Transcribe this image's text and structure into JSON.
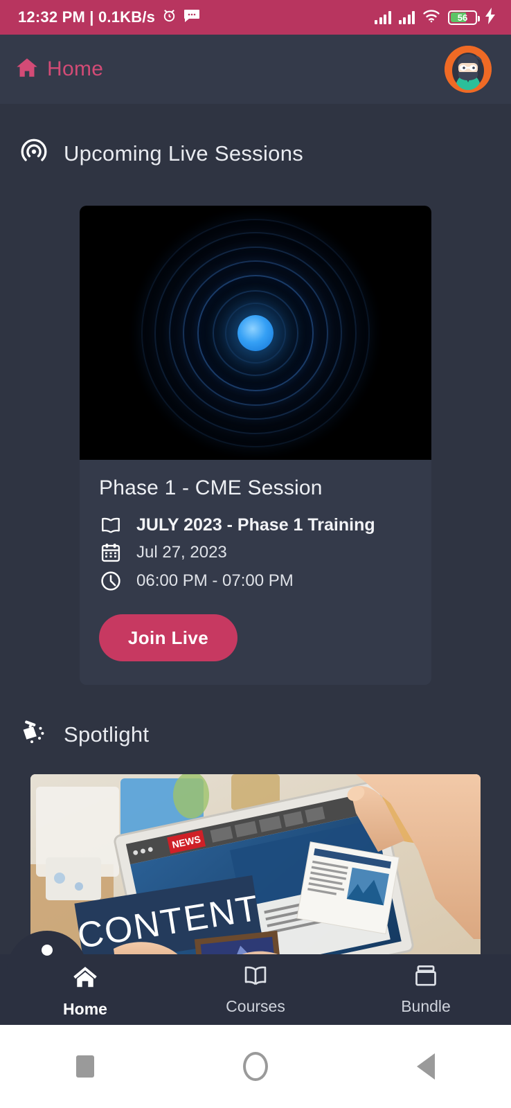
{
  "status_bar": {
    "time_and_speed": "12:32 PM | 0.1KB/s",
    "battery_level": "56",
    "icons": [
      "alarm-clock-icon",
      "message-icon",
      "signal-icon",
      "signal-icon",
      "wifi-icon",
      "battery-icon",
      "charging-bolt-icon"
    ],
    "background_color": "#b8355f"
  },
  "header": {
    "title": "Home",
    "home_icon": "home-icon",
    "accent_color": "#d34b76",
    "avatar": "ninja-avatar"
  },
  "sections": {
    "live": {
      "icon": "broadcast-icon",
      "title": "Upcoming Live Sessions"
    },
    "spotlight": {
      "icon": "spotlight-lamp-icon",
      "title": "Spotlight"
    }
  },
  "live_card": {
    "thumbnail": "blue-sonar-rings-graphic",
    "session_title": "Phase 1 - CME Session",
    "course": {
      "icon": "book-icon",
      "text": "JULY 2023 - Phase 1 Training"
    },
    "date": {
      "icon": "calendar-icon",
      "text": "Jul 27, 2023"
    },
    "time": {
      "icon": "clock-icon",
      "text": "06:00 PM - 07:00 PM"
    },
    "join_button": {
      "label": "Join Live",
      "color": "#c73961"
    }
  },
  "spotlight_card": {
    "image": "content-news-tablet-photo",
    "banner_text": "CONTENT"
  },
  "bottom_nav": {
    "items": [
      {
        "label": "Home",
        "icon": "home-icon",
        "active": true
      },
      {
        "label": "Courses",
        "icon": "open-book-icon",
        "active": false
      },
      {
        "label": "Bundle",
        "icon": "package-box-icon",
        "active": false
      }
    ]
  },
  "android_nav": {
    "recents": "square-recents-icon",
    "home": "circle-home-icon",
    "back": "triangle-back-icon"
  },
  "theme": {
    "page_background": "#2f3442",
    "card_background": "#343a4a",
    "nav_background": "#2b3040"
  }
}
